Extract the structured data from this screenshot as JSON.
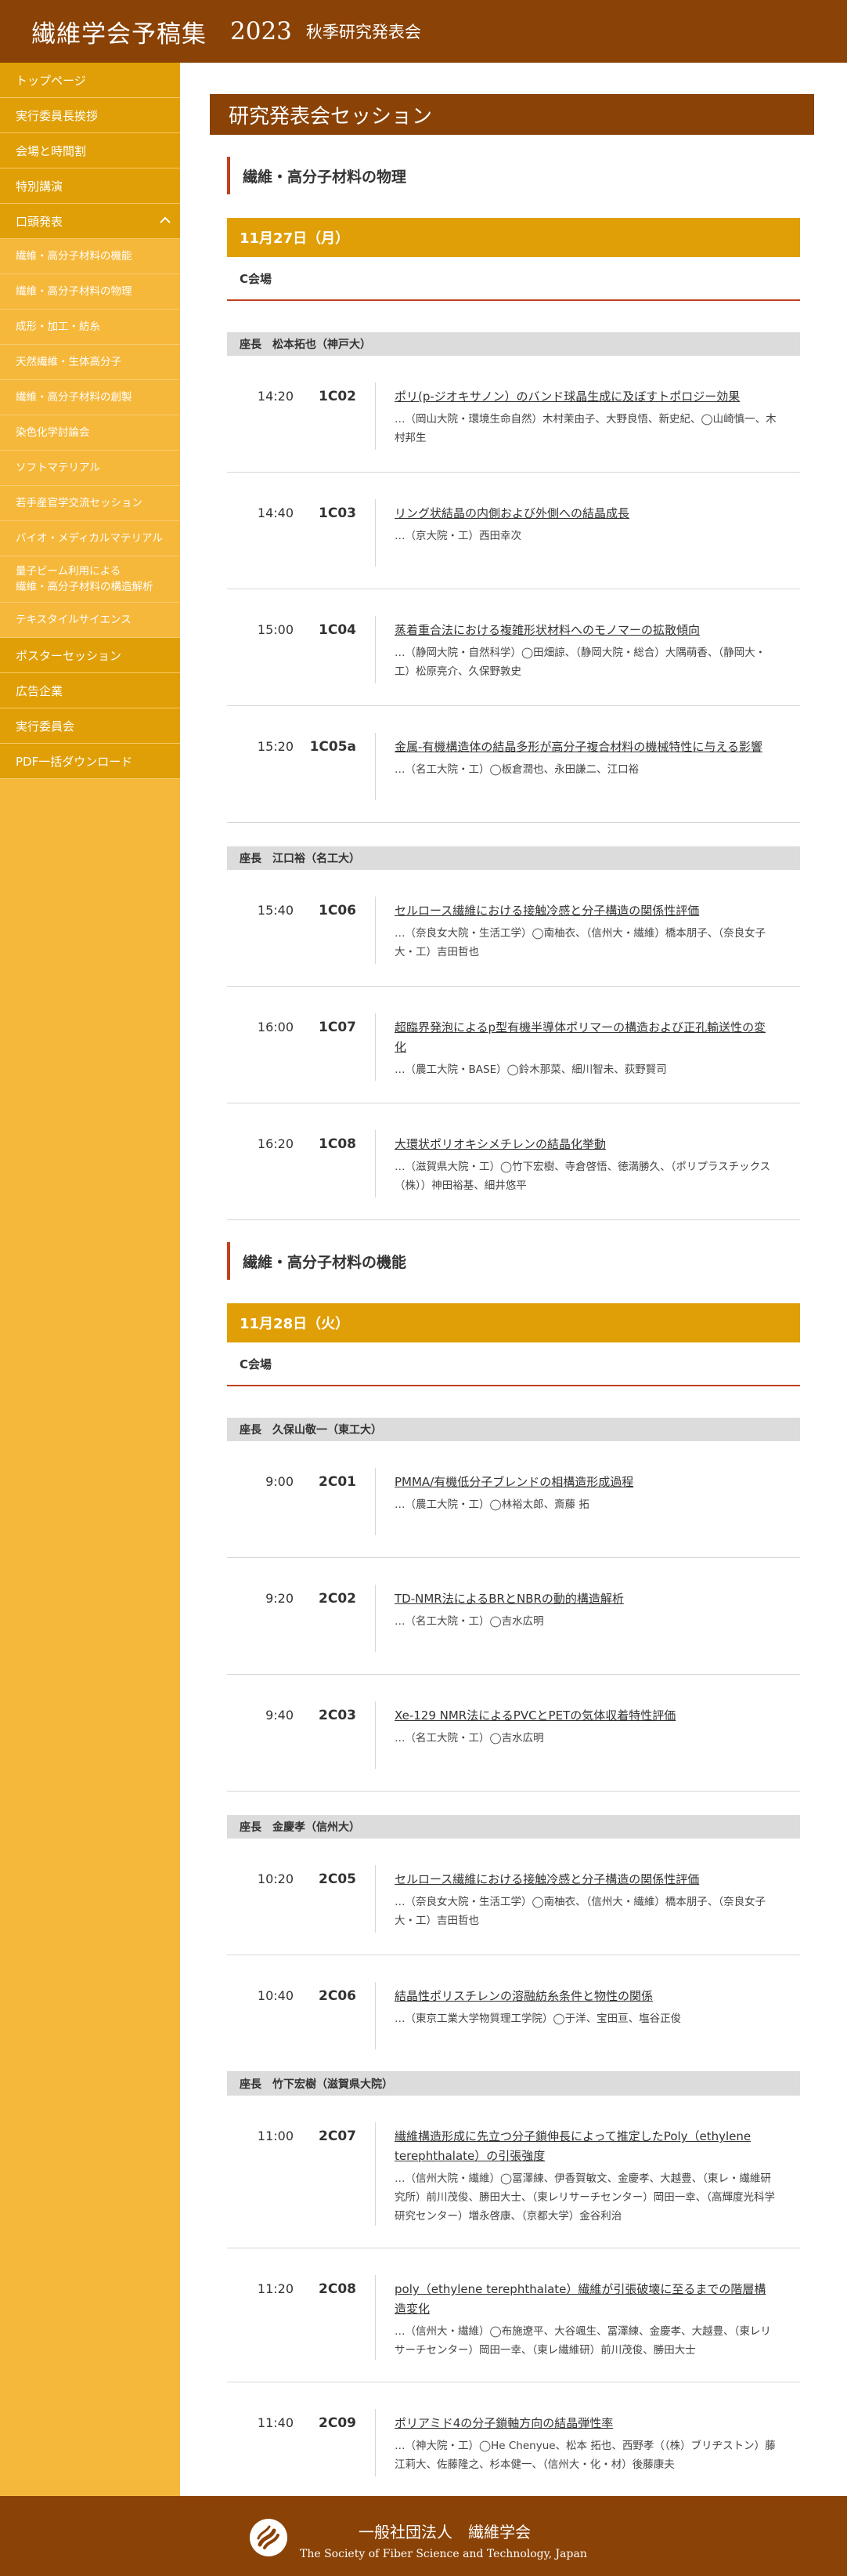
{
  "header": {
    "title": "繊維学会予稿集",
    "year": "2023",
    "subtitle": "秋季研究発表会"
  },
  "sidebar": {
    "items": [
      {
        "label": "トップページ"
      },
      {
        "label": "実行委員長挨拶"
      },
      {
        "label": "会場と時間割"
      },
      {
        "label": "特別講演"
      },
      {
        "label": "口頭発表"
      }
    ],
    "oral_sub": [
      {
        "label": "繊維・高分子材料の機能"
      },
      {
        "label": "繊維・高分子材料の物理"
      },
      {
        "label": "成形・加工・紡糸"
      },
      {
        "label": "天然繊維・生体高分子"
      },
      {
        "label": "繊維・高分子材料の創製"
      },
      {
        "label": "染色化学討論会"
      },
      {
        "label": "ソフトマテリアル"
      },
      {
        "label": "若手産官学交流セッション"
      },
      {
        "label": "バイオ・メディカルマテリアル"
      },
      {
        "label": "量子ビーム利用による"
      },
      {
        "label": "繊維・高分子材料の構造解析"
      },
      {
        "label": "テキスタイルサイエンス"
      }
    ],
    "bottom_items": [
      {
        "label": "ポスターセッション"
      },
      {
        "label": "広告企業"
      },
      {
        "label": "実行委員会"
      },
      {
        "label": "PDF一括ダウンロード"
      }
    ]
  },
  "page": {
    "title": "研究発表会セッション"
  },
  "sections": [
    {
      "heading": "繊維・高分子材料の物理",
      "date": "11月27日（月）",
      "room": "C会場",
      "groups": [
        {
          "chair": "座長　松本拓也（神戸大）",
          "talks": [
            {
              "time": "14:20",
              "code": "1C02",
              "title": "ポリ(p-ジオキサノン）のバンド球晶生成に及ぼすトポロジー効果",
              "authors": "…（岡山大院・環境生命自然）木村茉由子、大野良悟、新史紀、◯山崎慎一、木村邦生"
            },
            {
              "time": "14:40",
              "code": "1C03",
              "title": "リング状結晶の内側および外側への結晶成長",
              "authors": "…（京大院・工）西田幸次"
            },
            {
              "time": "15:00",
              "code": "1C04",
              "title": "蒸着重合法における複雑形状材料へのモノマーの拡散傾向",
              "authors": "…（静岡大院・自然科学）◯田畑諒、（静岡大院・総合）大隅萌香、（静岡大・工）松原亮介、久保野敦史"
            },
            {
              "time": "15:20",
              "code": "1C05a",
              "title": "金属-有機構造体の結晶多形が高分子複合材料の機械特性に与える影響",
              "authors": "…（名工大院・工）◯板倉潤也、永田謙二、江口裕"
            }
          ]
        },
        {
          "chair": "座長　江口裕（名工大）",
          "talks": [
            {
              "time": "15:40",
              "code": "1C06",
              "title": "セルロース繊維における接触冷感と分子構造の関係性評価",
              "authors": "…（奈良女大院・生活工学）◯南柚衣、（信州大・繊維）橋本朋子、（奈良女子大・工）吉田哲也"
            },
            {
              "time": "16:00",
              "code": "1C07",
              "title": "超臨界発泡によるp型有機半導体ポリマーの構造および正孔輸送性の変化",
              "authors": "…（農工大院・BASE）◯鈴木那菜、細川智未、荻野賢司"
            },
            {
              "time": "16:20",
              "code": "1C08",
              "title": "大環状ポリオキシメチレンの結晶化挙動",
              "authors": "…（滋賀県大院・工）◯竹下宏樹、寺倉啓悟、徳満勝久、（ポリプラスチックス（株））神田裕基、細井悠平"
            }
          ]
        }
      ]
    },
    {
      "heading": "繊維・高分子材料の機能",
      "date": "11月28日（火）",
      "room": "C会場",
      "groups": [
        {
          "chair": "座長　久保山敬一（東工大）",
          "talks": [
            {
              "time": "9:00",
              "code": "2C01",
              "title": "PMMA/有機低分子ブレンドの相構造形成過程",
              "authors": "…（農工大院・工）◯林裕太郎、斎藤 拓"
            },
            {
              "time": "9:20",
              "code": "2C02",
              "title": "TD-NMR法によるBRとNBRの動的構造解析",
              "authors": "…（名工大院・工）◯吉水広明"
            },
            {
              "time": "9:40",
              "code": "2C03",
              "title": "Xe-129 NMR法によるPVCとPETの気体収着特性評価",
              "authors": "…（名工大院・工）◯吉水広明"
            }
          ]
        },
        {
          "chair": "座長　金慶孝（信州大）",
          "talks": [
            {
              "time": "10:20",
              "code": "2C05",
              "title": "セルロース繊維における接触冷感と分子構造の関係性評価",
              "authors": "…（奈良女大院・生活工学）◯南柚衣、（信州大・繊維）橋本朋子、（奈良女子大・工）吉田哲也"
            },
            {
              "time": "10:40",
              "code": "2C06",
              "title": "結晶性ポリスチレンの溶融紡糸条件と物性の関係",
              "authors": "…（東京工業大学物質理工学院）◯于洋、宝田亘、塩谷正俊"
            }
          ]
        },
        {
          "chair": "座長　竹下宏樹（滋賀県大院）",
          "talks": [
            {
              "time": "11:00",
              "code": "2C07",
              "title": "繊維構造形成に先立つ分子鎖伸長によって推定したPoly（ethylene terephthalate）の引張強度",
              "authors": "…（信州大院・繊維）◯冨澤練、伊香賀敏文、金慶孝、大越豊、（東レ・繊維研究所）前川茂俊、勝田大士、（東レリサーチセンター）岡田一幸、（高輝度光科学研究センター）増永啓康、（京都大学）金谷利治"
            },
            {
              "time": "11:20",
              "code": "2C08",
              "title": "poly（ethylene terephthalate）繊維が引張破壊に至るまでの階層構造変化",
              "authors": "…（信州大・繊維）◯布施遼平、大谷颯生、冨澤練、金慶孝、大越豊、（東レリサーチセンター）岡田一幸、（東レ繊維研）前川茂俊、勝田大士"
            },
            {
              "time": "11:40",
              "code": "2C09",
              "title": "ポリアミド4の分子鎖軸方向の結晶弾性率",
              "authors": "…（神大院・工）◯He Chenyue、松本 拓也、西野孝（（株）ブリヂストン）藤江莉大、佐藤隆之、杉本健一、（信州大・化・材）後藤康夫"
            }
          ]
        }
      ]
    }
  ],
  "footer": {
    "org_ja": "一般社団法人　繊維学会",
    "org_en": "The Society of Fiber Science and Technology, Japan",
    "logo": "society-logo"
  }
}
